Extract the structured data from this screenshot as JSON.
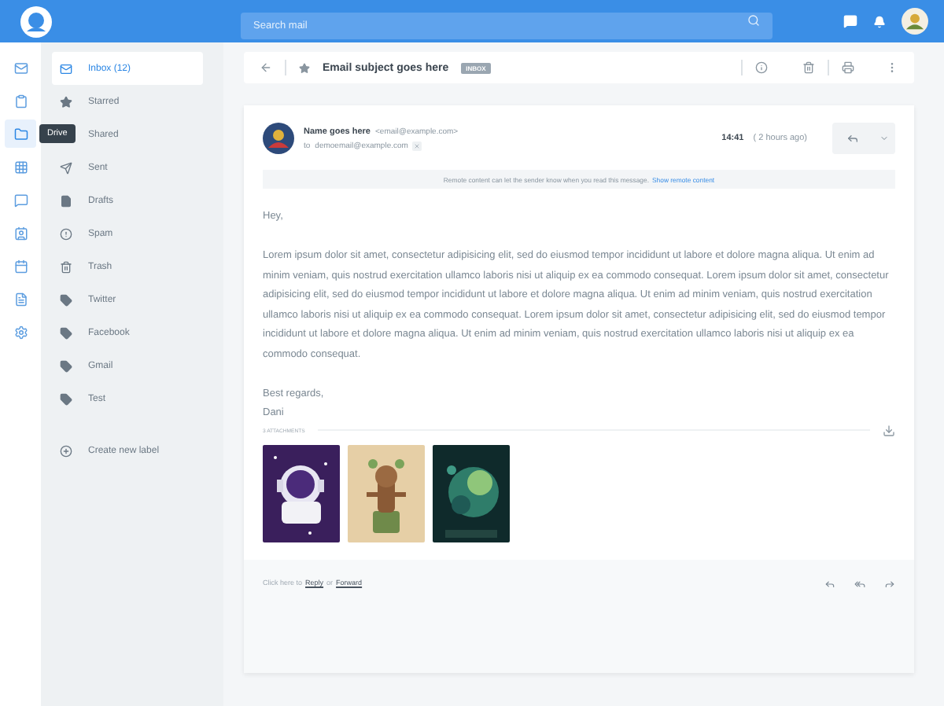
{
  "topbar": {
    "search": {
      "placeholder": "Search mail"
    }
  },
  "rail": [
    {
      "selected": false
    },
    {
      "selected": false
    },
    {
      "selected": true,
      "tooltip": "Drive"
    },
    {
      "selected": false
    },
    {
      "selected": false
    },
    {
      "selected": false
    },
    {
      "selected": false
    },
    {
      "selected": false
    },
    {
      "selected": false
    }
  ],
  "folders": [
    {
      "label": "Inbox (12)",
      "selected": true
    },
    {
      "label": "Starred",
      "selected": false
    },
    {
      "label": "Shared",
      "selected": false
    },
    {
      "label": "Sent",
      "selected": false
    },
    {
      "label": "Drafts",
      "selected": false
    },
    {
      "label": "Spam",
      "selected": false
    },
    {
      "label": "Trash",
      "selected": false
    },
    {
      "label": "Twitter",
      "selected": false
    },
    {
      "label": "Facebook",
      "selected": false
    },
    {
      "label": "Gmail",
      "selected": false
    },
    {
      "label": "Test",
      "selected": false
    }
  ],
  "create_label": "Create new label",
  "toolbar": {
    "subject": "Email subject goes here",
    "badge": "INBOX"
  },
  "message": {
    "sender_name": "Name goes here",
    "sender_email": "<email@example.com>",
    "to_label": "to",
    "to": "demoemail@example.com",
    "time": "14:41",
    "ago": "( 2 hours ago)",
    "notice": "Remote content can let the sender know when you read this message.",
    "notice_link": "Show remote content",
    "greeting": "Hey,",
    "body": "Lorem ipsum dolor sit amet, consectetur adipisicing elit, sed do eiusmod tempor incididunt ut labore et dolore magna aliqua. Ut enim ad minim veniam, quis nostrud exercitation ullamco laboris nisi ut aliquip ex ea commodo consequat. Lorem ipsum dolor sit amet, consectetur adipisicing elit, sed do eiusmod tempor incididunt ut labore et dolore magna aliqua. Ut enim ad minim veniam, quis nostrud exercitation ullamco laboris nisi ut aliquip ex ea commodo consequat. Lorem ipsum dolor sit amet, consectetur adipisicing elit, sed do eiusmod tempor incididunt ut labore et dolore magna aliqua. Ut enim ad minim veniam, quis nostrud exercitation ullamco laboris nisi ut aliquip ex ea commodo consequat.",
    "closing": "Best regards,",
    "signature": "Dani",
    "attachments_label": "3 ATTACHMENTS"
  },
  "footer": {
    "prefix": "Click here to",
    "reply": "Reply",
    "or": "or",
    "forward": "Forward"
  }
}
